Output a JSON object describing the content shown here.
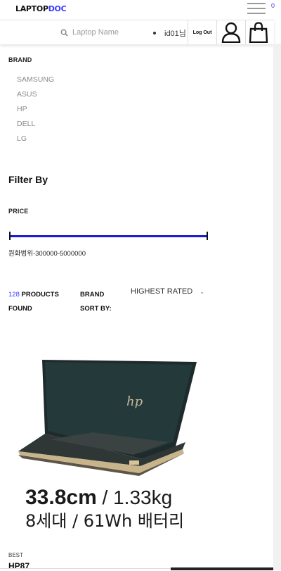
{
  "header": {
    "logo_main": "LAPTOP",
    "logo_accent": "DOC",
    "search_placeholder": "Laptop Name",
    "user_id": "id01님",
    "logout_label": "Log Out",
    "cart_count": "0",
    "accent_color": "#3a3aff"
  },
  "filters": {
    "brand_label": "BRAND",
    "brands": [
      "SAMSUNG",
      "ASUS",
      "HP",
      "DELL",
      "LG"
    ],
    "filter_title": "Filter By",
    "price_label": "PRICE",
    "price_range_text": "원화범위-300000-5000000",
    "slider_color": "#1a1ad8"
  },
  "results": {
    "count": "128",
    "count_label": "PRODUCTS",
    "found_label": "FOUND",
    "brand_label": "BRAND",
    "sort_label": "SORT BY:",
    "sort_value": "HIGHEST RATED"
  },
  "product": {
    "badge": "BEST",
    "name": "HP87",
    "image_text_line1_a": "33.8cm",
    "image_text_line1_b": " / 1.33kg",
    "image_text_line2": "8세대 / 61Wh 배터리"
  }
}
